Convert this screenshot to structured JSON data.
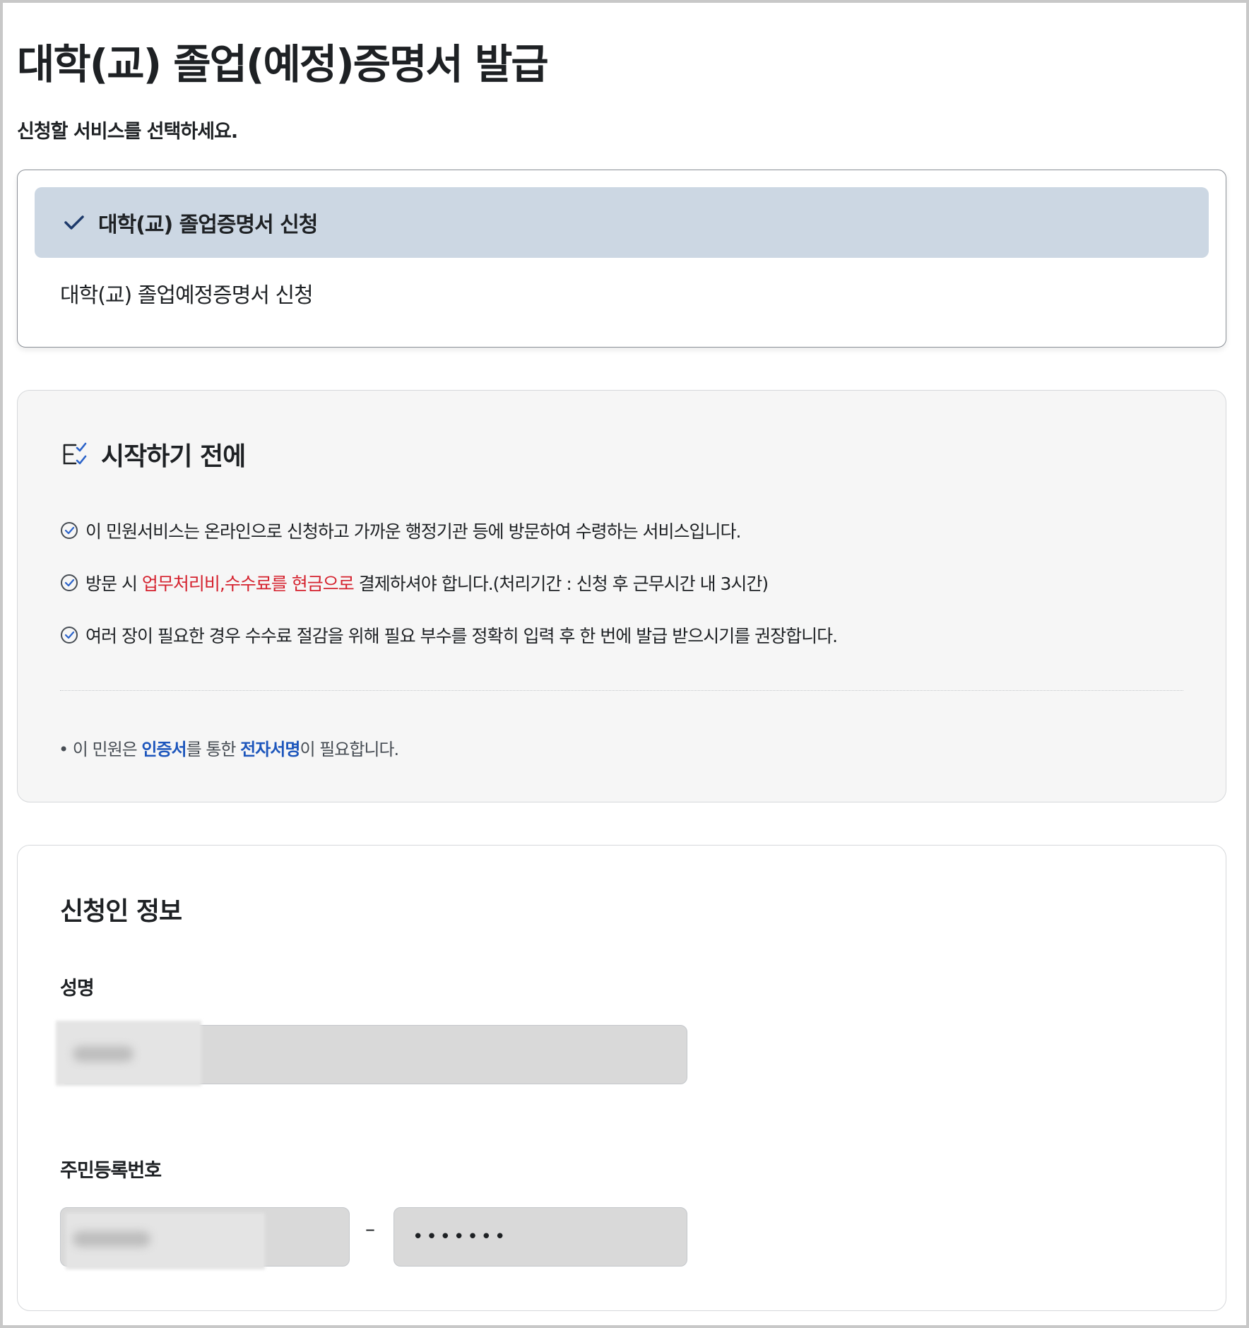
{
  "header": {
    "title": "대학(교) 졸업(예정)증명서 발급",
    "subtitle": "신청할 서비스를 선택하세요."
  },
  "service_options": [
    {
      "label": "대학(교) 졸업증명서 신청",
      "selected": true
    },
    {
      "label": "대학(교) 졸업예정증명서 신청",
      "selected": false
    }
  ],
  "before_start": {
    "title": "시작하기 전에",
    "items": [
      {
        "text": "이 민원서비스는 온라인으로 신청하고 가까운 행정기관 등에 방문하여 수령하는 서비스입니다."
      },
      {
        "prefix": "방문 시 ",
        "highlight": "업무처리비,수수료를 현금으로",
        "suffix": " 결제하셔야 합니다.(처리기간 : 신청 후 근무시간 내 3시간)"
      },
      {
        "text": "여러 장이 필요한 경우 수수료 절감을 위해 필요 부수를 정확히 입력 후 한 번에 발급 받으시기를 권장합니다."
      }
    ],
    "note": {
      "p1": "이 민원은 ",
      "link1": "인증서",
      "p2": "를 통한 ",
      "link2": "전자서명",
      "p3": "이 필요합니다."
    }
  },
  "applicant": {
    "title": "신청인 정보",
    "name_label": "성명",
    "rrn_label": "주민등록번호",
    "rrn_separator": "–",
    "rrn_back_masked": "•••••••"
  },
  "colors": {
    "selected_bg": "#ccd7e3",
    "highlight_red": "#d5232f",
    "link_blue": "#1d56bc",
    "check_navy": "#1d3a6b"
  }
}
